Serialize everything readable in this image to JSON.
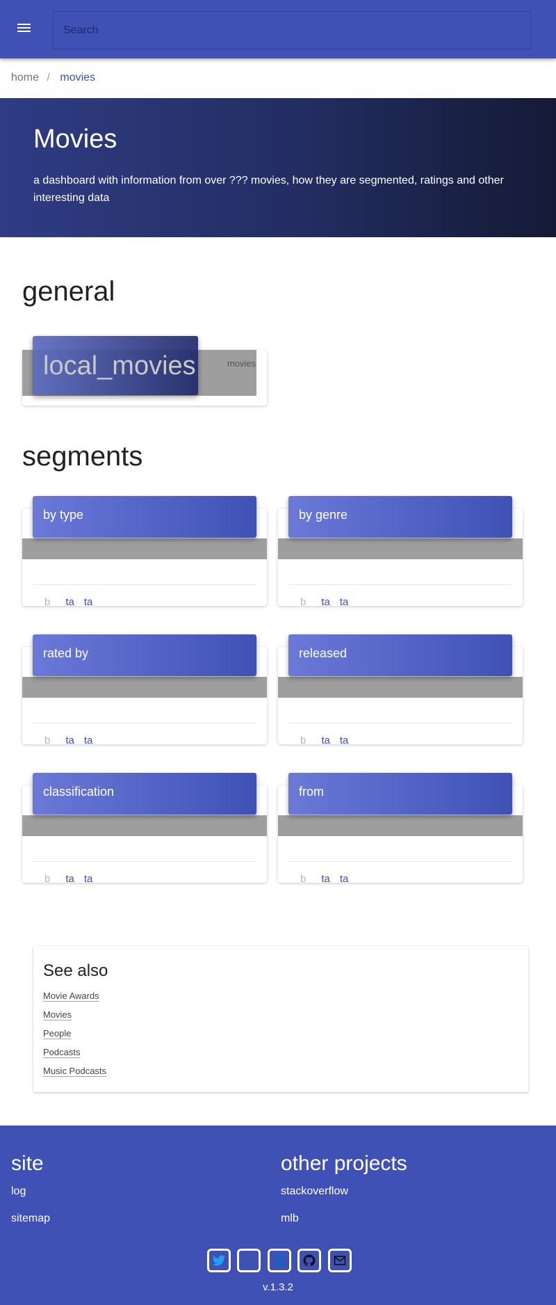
{
  "search": {
    "placeholder": "Search"
  },
  "breadcrumb": {
    "home": "home",
    "separator": "/",
    "current": "movies"
  },
  "hero": {
    "title": "Movies",
    "description": "a dashboard with information from over ??? movies, how they are segmented, ratings and other interesting data"
  },
  "general": {
    "title": "general",
    "card": {
      "icon": "local_movies",
      "label": "movies"
    }
  },
  "segments": {
    "title": "segments",
    "cards": [
      {
        "label": "by type",
        "b": "b",
        "ta1": "ta",
        "ta2": "ta"
      },
      {
        "label": "by genre",
        "b": "b",
        "ta1": "ta",
        "ta2": "ta"
      },
      {
        "label": "rated by",
        "b": "b",
        "ta1": "ta",
        "ta2": "ta"
      },
      {
        "label": "released",
        "b": "b",
        "ta1": "ta",
        "ta2": "ta"
      },
      {
        "label": "classification",
        "b": "b",
        "ta1": "ta",
        "ta2": "ta"
      },
      {
        "label": "from",
        "b": "b",
        "ta1": "ta",
        "ta2": "ta"
      }
    ]
  },
  "see_also": {
    "title": "See also",
    "links": [
      "Movie Awards",
      "Movies",
      "People",
      "Podcasts",
      "Music Podcasts"
    ]
  },
  "footer": {
    "site": {
      "title": "site",
      "links": [
        "log",
        "sitemap"
      ]
    },
    "other": {
      "title": "other projects",
      "links": [
        "stackoverflow",
        "mlb"
      ]
    },
    "social_icons": [
      "twitter-icon",
      "facebook-icon",
      "linkedin-icon",
      "github-icon",
      "email-icon"
    ],
    "version": "v.1.3.2"
  },
  "colors": {
    "primary": "#3f51b5",
    "hero_dark": "#141a36",
    "band_gray": "#9e9e9e"
  }
}
